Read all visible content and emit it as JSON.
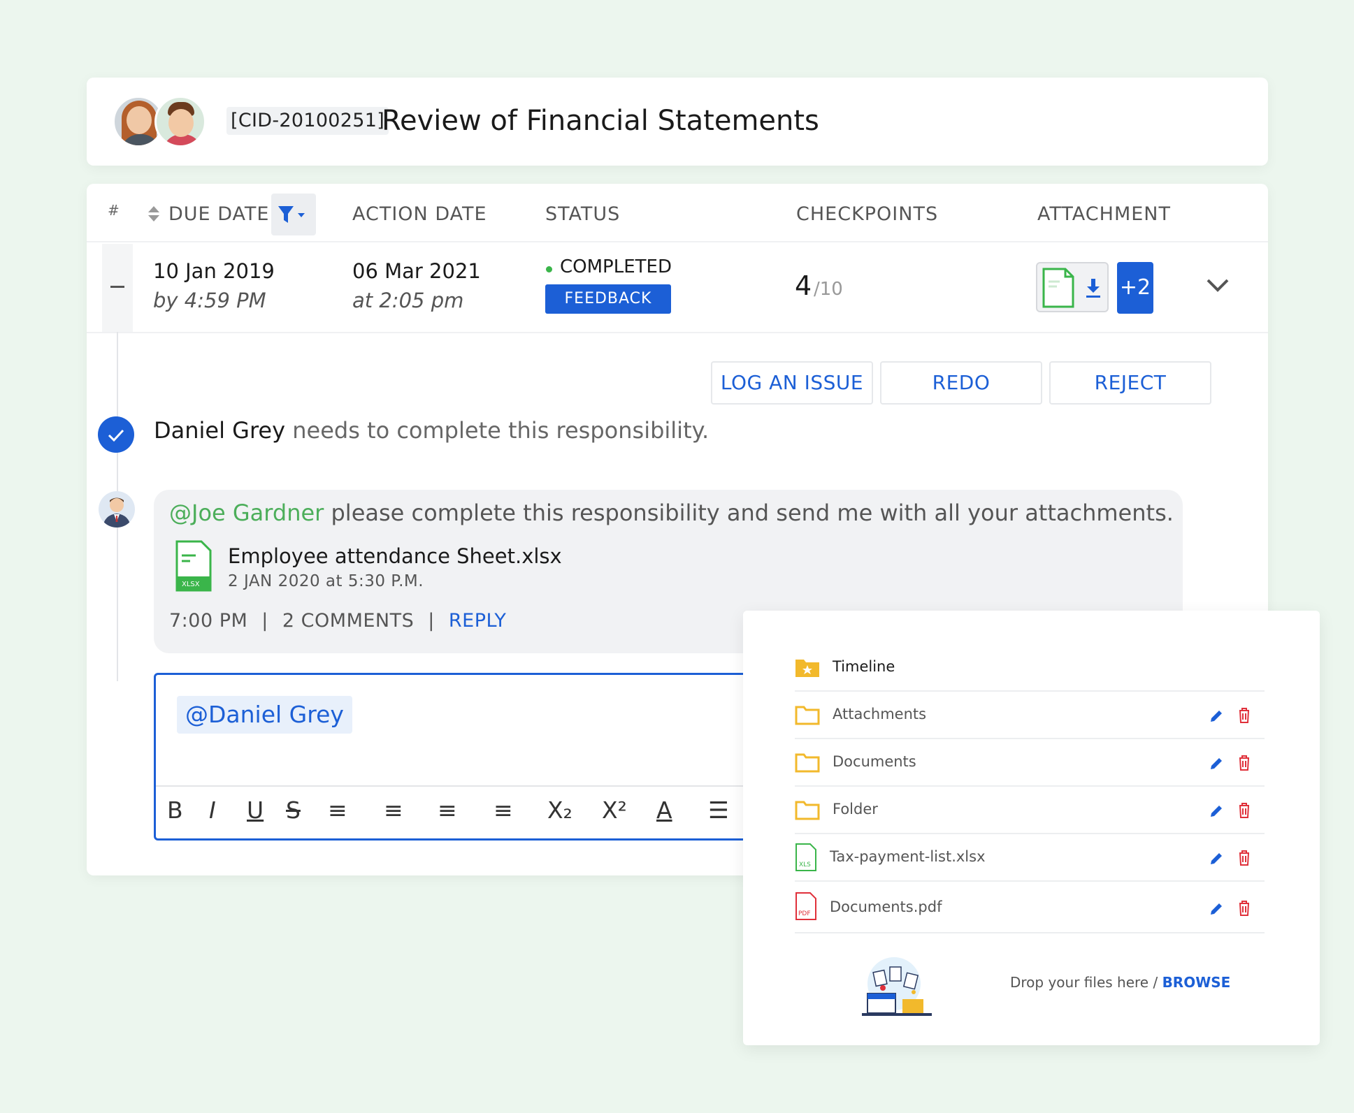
{
  "header": {
    "cid": "[CID-20100251]",
    "title": "Review of Financial Statements"
  },
  "table": {
    "headers": {
      "hash": "#",
      "due_date": "DUE DATE",
      "action_date": "ACTION DATE",
      "status": "STATUS",
      "checkpoints": "CHECKPOINTS",
      "attachment": "ATTACHMENT"
    },
    "row": {
      "due_date": "10 Jan 2019",
      "due_time": "by 4:59 PM",
      "action_date": "06 Mar 2021",
      "action_time": "at 2:05 pm",
      "status": "COMPLETED",
      "feedback_label": "FEEDBACK",
      "checkpoints_done": "4",
      "checkpoints_total": "/10",
      "extra_attachments": "+2"
    }
  },
  "actions": {
    "log_issue": "LOG AN ISSUE",
    "redo": "REDO",
    "reject": "REJECT"
  },
  "assignment": {
    "name": "Daniel Grey",
    "text": " needs to complete this responsibility."
  },
  "comment": {
    "mention": "@Joe Gardner",
    "text": " please complete this responsibility and send me with all your attachments.",
    "attachment_name": "Employee attendance Sheet.xlsx",
    "attachment_date": "2 JAN 2020  at 5:30 P.M.",
    "time": "7:00 PM",
    "comments_count": "2  COMMENTS",
    "reply_label": "REPLY",
    "separator": "|"
  },
  "editor": {
    "mention_chip": "@Daniel Grey",
    "toolbar": [
      "B",
      "I",
      "U",
      "S",
      "≡",
      "≡",
      "≡",
      "≡",
      "X₂",
      "X²",
      "A",
      "☰"
    ]
  },
  "files": {
    "items": [
      {
        "name": "Timeline",
        "type": "folder-star",
        "actions": false
      },
      {
        "name": "Attachments",
        "type": "folder",
        "actions": true
      },
      {
        "name": "Documents",
        "type": "folder",
        "actions": true
      },
      {
        "name": "Folder",
        "type": "folder",
        "actions": true
      },
      {
        "name": "Tax-payment-list.xlsx",
        "type": "xls",
        "actions": true
      },
      {
        "name": "Documents.pdf",
        "type": "pdf",
        "actions": true
      }
    ],
    "drop_text": "Drop your files here / ",
    "browse_label": "BROWSE"
  },
  "colors": {
    "accent": "#1c5fd6",
    "success": "#3ab54a",
    "mention": "#4cae5a",
    "folder": "#f2b92c",
    "danger": "#e0303a"
  }
}
